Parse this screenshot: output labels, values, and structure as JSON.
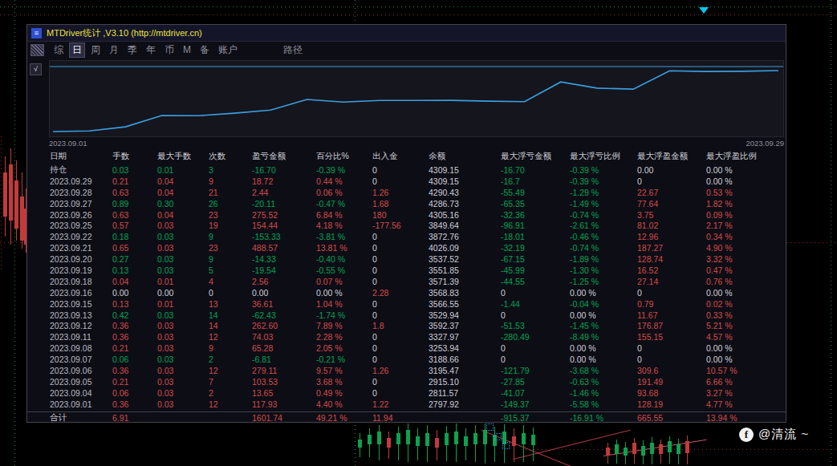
{
  "background": {
    "watermark": {
      "icon": "f",
      "text": "@清流 ~"
    }
  },
  "window": {
    "title": "MTDriver统计 ,V3.10 (http://mtdriver.cn)",
    "icons": {
      "window": "≡",
      "check": "√"
    },
    "menu": {
      "items": [
        "综",
        "日",
        "周",
        "月",
        "季",
        "年",
        "币",
        "M",
        "备",
        "账户",
        "路径"
      ],
      "selected_index": 1
    },
    "table": {
      "headers": [
        "日期",
        "手数",
        "最大手数",
        "次数",
        "盈亏金额",
        "百分比%",
        "出入金",
        "余额",
        "最大浮亏金额",
        "最大浮亏比例",
        "最大浮盈金额",
        "最大浮盈比例"
      ],
      "rows": [
        [
          "持仓",
          "0.03",
          "0.01",
          "3",
          "-16.70",
          "-0.39 %",
          "0",
          "4309.15",
          "-16.70",
          "-0.39 %",
          "0.00",
          "0.00 %"
        ],
        [
          "2023.09.29",
          "0.21",
          "0.04",
          "9",
          "18.72",
          "0.44 %",
          "0",
          "4309.15",
          "-16.7",
          "-0.39 %",
          "0",
          "0.00 %"
        ],
        [
          "2023.09.28",
          "0.63",
          "0.04",
          "21",
          "2.44",
          "0.06 %",
          "1.26",
          "4290.43",
          "-55.49",
          "-1.29 %",
          "22.67",
          "0.53 %"
        ],
        [
          "2023.09.27",
          "0.89",
          "0.30",
          "26",
          "-20.11",
          "-0.47 %",
          "1.68",
          "4286.73",
          "-65.35",
          "-1.49 %",
          "77.64",
          "1.82 %"
        ],
        [
          "2023.09.26",
          "0.63",
          "0.04",
          "23",
          "275.52",
          "6.84 %",
          "180",
          "4305.16",
          "-32.36",
          "-0.74 %",
          "3.75",
          "0.09 %"
        ],
        [
          "2023.09.25",
          "0.57",
          "0.03",
          "19",
          "154.44",
          "4.18 %",
          "-177.56",
          "3849.64",
          "-96.91",
          "-2.61 %",
          "81.02",
          "2.17 %"
        ],
        [
          "2023.09.22",
          "0.18",
          "0.03",
          "9",
          "-153.33",
          "-3.81 %",
          "0",
          "3872.76",
          "-18.01",
          "-0.46 %",
          "12.96",
          "0.34 %"
        ],
        [
          "2023.09.21",
          "0.65",
          "0.03",
          "23",
          "488.57",
          "13.81 %",
          "0",
          "4026.09",
          "-32.19",
          "-0.74 %",
          "187.27",
          "4.90 %"
        ],
        [
          "2023.09.20",
          "0.27",
          "0.03",
          "9",
          "-14.33",
          "-0.40 %",
          "0",
          "3537.52",
          "-67.15",
          "-1.89 %",
          "128.74",
          "3.32 %"
        ],
        [
          "2023.09.19",
          "0.13",
          "0.03",
          "5",
          "-19.54",
          "-0.55 %",
          "0",
          "3551.85",
          "-45.99",
          "-1.30 %",
          "16.52",
          "0.47 %"
        ],
        [
          "2023.09.18",
          "0.04",
          "0.01",
          "4",
          "2.56",
          "0.07 %",
          "0",
          "3571.39",
          "-44.55",
          "-1.25 %",
          "27.14",
          "0.76 %"
        ],
        [
          "2023.09.16",
          "0.00",
          "0.00",
          "0",
          "0.00",
          "0.00 %",
          "2.28",
          "3568.83",
          "0",
          "0.00 %",
          "0",
          "0.00 %"
        ],
        [
          "2023.09.15",
          "0.13",
          "0.01",
          "13",
          "36.61",
          "1.04 %",
          "0",
          "3566.55",
          "-1.44",
          "-0.04 %",
          "0.79",
          "0.02 %"
        ],
        [
          "2023.09.13",
          "0.42",
          "0.03",
          "14",
          "-62.43",
          "-1.74 %",
          "0",
          "3529.94",
          "0",
          "0.00 %",
          "11.67",
          "0.33 %"
        ],
        [
          "2023.09.12",
          "0.36",
          "0.03",
          "14",
          "262.60",
          "7.89 %",
          "1.8",
          "3592.37",
          "-51.53",
          "-1.45 %",
          "176.87",
          "5.21 %"
        ],
        [
          "2023.09.11",
          "0.36",
          "0.03",
          "12",
          "74.03",
          "2.28 %",
          "0",
          "3327.97",
          "-280.49",
          "-8.49 %",
          "155.15",
          "4.57 %"
        ],
        [
          "2023.09.08",
          "0.21",
          "0.03",
          "9",
          "65.28",
          "2.05 %",
          "0",
          "3253.94",
          "0",
          "0.00 %",
          "0",
          "0.00 %"
        ],
        [
          "2023.09.07",
          "0.06",
          "0.03",
          "2",
          "-6.81",
          "-0.21 %",
          "0",
          "3188.66",
          "0",
          "0.00 %",
          "0",
          "0.00 %"
        ],
        [
          "2023.09.06",
          "0.36",
          "0.03",
          "12",
          "279.11",
          "9.57 %",
          "1.26",
          "3195.47",
          "-121.79",
          "-3.68 %",
          "309.6",
          "10.57 %"
        ],
        [
          "2023.09.05",
          "0.21",
          "0.03",
          "7",
          "103.53",
          "3.68 %",
          "0",
          "2915.10",
          "-27.85",
          "-0.63 %",
          "191.49",
          "6.66 %"
        ],
        [
          "2023.09.04",
          "0.06",
          "0.03",
          "2",
          "13.65",
          "0.49 %",
          "0",
          "2811.57",
          "-41.07",
          "-1.46 %",
          "93.68",
          "3.27 %"
        ],
        [
          "2023.09.01",
          "0.36",
          "0.03",
          "12",
          "117.93",
          "4.40 %",
          "1.22",
          "2797.92",
          "-149.37",
          "-5.58 %",
          "128.19",
          "4.77 %"
        ]
      ],
      "total": [
        "合计",
        "6.91",
        "",
        "",
        "1601.74",
        "49.21 %",
        "11.94",
        "",
        "-915.37",
        "-16.91 %",
        "665.55",
        "13.94 %"
      ]
    }
  },
  "chart_data": {
    "type": "line",
    "xlabel_left": "2023.09.01",
    "xlabel_right": "2023.09.29",
    "x": [
      "2023.09.01",
      "2023.09.04",
      "2023.09.05",
      "2023.09.06",
      "2023.09.07",
      "2023.09.08",
      "2023.09.11",
      "2023.09.12",
      "2023.09.13",
      "2023.09.15",
      "2023.09.16",
      "2023.09.18",
      "2023.09.19",
      "2023.09.20",
      "2023.09.21",
      "2023.09.22",
      "2023.09.25",
      "2023.09.26",
      "2023.09.27",
      "2023.09.28",
      "2023.09.29"
    ],
    "series": [
      {
        "name": "余额",
        "values": [
          2797.92,
          2811.57,
          2915.1,
          3195.47,
          3188.66,
          3253.94,
          3327.97,
          3592.37,
          3529.94,
          3566.55,
          3568.83,
          3571.39,
          3551.85,
          3537.52,
          4026.09,
          3872.76,
          3849.64,
          4305.16,
          4286.73,
          4290.43,
          4309.15
        ]
      }
    ],
    "ylim": [
      2797.92,
      4309.15
    ],
    "line_color": "#3b9fe0",
    "legend": "none",
    "grid": "off"
  }
}
